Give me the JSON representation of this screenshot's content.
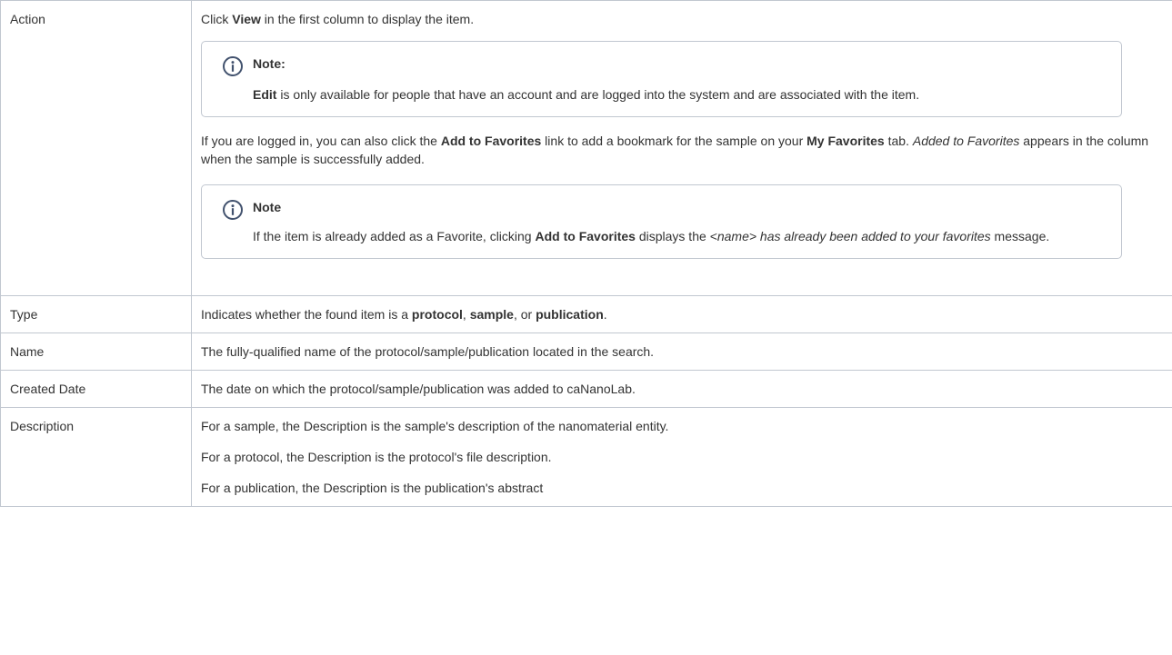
{
  "rows": [
    {
      "label": "Action",
      "para1": {
        "t1": "Click ",
        "b1": "View",
        "t2": " in the first column to display the item."
      },
      "note1": {
        "title": "Note:",
        "b1": "Edit",
        "t1": " is only available for people that have an account and are logged into the system and are associated with the item."
      },
      "para2": {
        "t1": "If you are logged in, you can also click the ",
        "b1": "Add to Favorites",
        "t2": " link to add a bookmark for the sample on your ",
        "b2": "My Favorites",
        "t3": " tab. ",
        "i1": "Added to Favorites",
        "t4": " appears in the column when the sample is successfully added."
      },
      "note2": {
        "title": "Note",
        "t1": "If the item is already added as a Favorite, clicking ",
        "b1": "Add to Favorites",
        "t2": " displays the ",
        "i1": "<name> has already been added to your favorites",
        "t3": " message."
      }
    },
    {
      "label": "Type",
      "t1": "Indicates whether the found item is a ",
      "b1": "protocol",
      "t2": ", ",
      "b2": "sample",
      "t3": ", or ",
      "b3": "publication",
      "t4": "."
    },
    {
      "label": "Name",
      "text": "The fully-qualified name of the protocol/sample/publication located in the search."
    },
    {
      "label": "Created Date",
      "text": "The date on which the protocol/sample/publication was added to caNanoLab."
    },
    {
      "label": "Description",
      "p1": "For a sample, the Description is the sample's description of the nanomaterial entity.",
      "p2": "For a protocol, the Description is the protocol's file description.",
      "p3": "For a publication, the Description is the publication's abstract"
    }
  ],
  "icons": {
    "note_icon": "info-icon"
  },
  "colors": {
    "text": "#333333",
    "border": "#c1c7d0",
    "icon": "#42526e"
  }
}
